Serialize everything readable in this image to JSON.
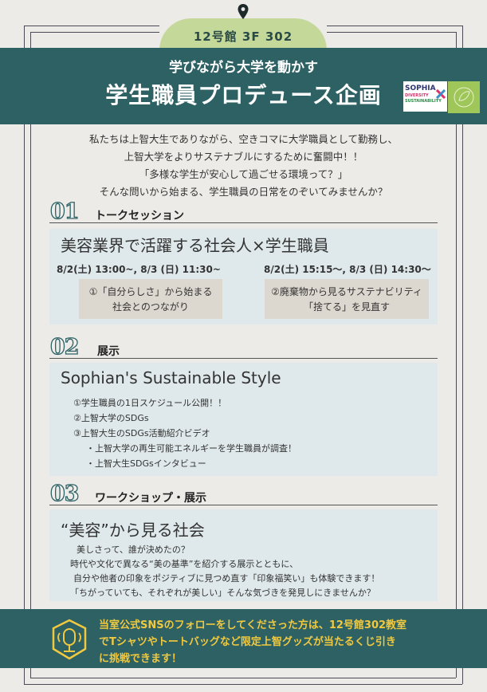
{
  "location": "12号館 3F 302",
  "header": {
    "subtitle": "学びながら大学を動かす",
    "title": "学生職員プロデュース企画",
    "logo_lines": [
      "SOPHIA",
      "DIVERSITY",
      "SUSTAINABILITY"
    ]
  },
  "intro": [
    "私たちは上智大生でありながら、空きコマに大学職員として勤務し、",
    "上智大学をよりサステナブルにするために奮闘中！！",
    "「多様な学生が安心して過ごせる環境って？」",
    "そんな問いから始まる、学生職員の日常をのぞいてみませんか？"
  ],
  "section1": {
    "num": "01",
    "title": "トークセッション",
    "panel_title": "美容業界で活躍する社会人×学生職員",
    "sessions": [
      {
        "date": "8/2(土) 13:00~, 8/3 (日) 11:30~",
        "lines": [
          "①「自分らしさ」から始まる",
          "社会とのつながり"
        ]
      },
      {
        "date": "8/2(土) 15:15～, 8/3 (日) 14:30～",
        "lines": [
          "②廃棄物から見るサステナビリティ",
          "「捨てる」を見直す"
        ]
      }
    ]
  },
  "section2": {
    "num": "02",
    "title": "展示",
    "panel_title": "Sophian's Sustainable Style",
    "items": [
      "①学生職員の1日スケジュール公開！！",
      "②上智大学のSDGs",
      "③上智大生のSDGs活動紹介ビデオ",
      "・上智大学の再生可能エネルギーを学生職員が調査！",
      "・上智大生SDGsインタビュー"
    ]
  },
  "section3": {
    "num": "03",
    "title": "ワークショップ・展示",
    "panel_title": "“美容”から見る社会",
    "lines": [
      "美しさって、誰が決めたの？",
      "時代や文化で異なる“美の基準”を紹介する展示とともに、",
      "自分や他者の印象をポジティブに見つめ直す「印象福笑い」も体験できます！",
      "「ちがっていても、それぞれが美しい」そんな気づきを発見しにきませんか？"
    ]
  },
  "footer": {
    "lines": [
      "当室公式SNSのフォローをしてくださった方は、12号館302教室",
      "でTシャツやトートバッグなど限定上智グッズが当たるくじ引き",
      "に挑戦できます！"
    ]
  },
  "colors": {
    "teal": "#2d6164",
    "lime": "#c4d89a",
    "gold": "#f0c940",
    "panel": "#dfe8ea",
    "beige": "#dcd7cf"
  }
}
